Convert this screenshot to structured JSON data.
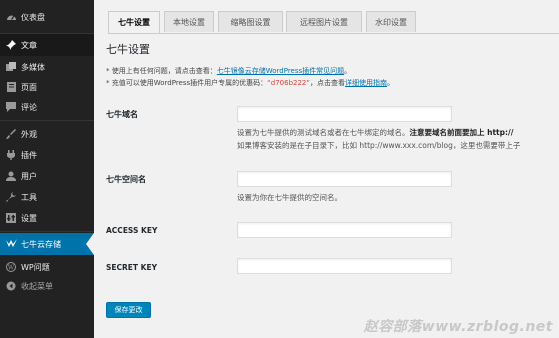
{
  "sidebar": {
    "items": [
      {
        "label": "仪表盘",
        "icon": "dashboard-icon"
      },
      {
        "label": "文章",
        "icon": "pin-icon"
      },
      {
        "label": "多媒体",
        "icon": "media-icon"
      },
      {
        "label": "页面",
        "icon": "page-icon"
      },
      {
        "label": "评论",
        "icon": "comment-icon"
      },
      {
        "label": "外观",
        "icon": "brush-icon"
      },
      {
        "label": "插件",
        "icon": "plugin-icon"
      },
      {
        "label": "用户",
        "icon": "user-icon"
      },
      {
        "label": "工具",
        "icon": "wrench-icon"
      },
      {
        "label": "设置",
        "icon": "settings-icon"
      },
      {
        "label": "七牛云存储",
        "icon": "qiniu-icon"
      },
      {
        "label": "WP问题",
        "icon": "wordpress-icon"
      },
      {
        "label": "收起菜单",
        "icon": "collapse-icon"
      }
    ],
    "colors": {
      "bg": "#222222",
      "active": "#0073aa"
    }
  },
  "tabs": [
    "七牛设置",
    "本地设置",
    "缩略图设置",
    "远程图片设置",
    "水印设置"
  ],
  "page": {
    "title": "七牛设置",
    "note1_prefix": "* 使用上有任何问题，请点击查看：",
    "note1_link": "七牛镜像云存储WordPress插件常见问题",
    "note1_suffix": "。",
    "note2_prefix": "* 充值可以使用WordPress插件用户专属的优惠码：",
    "note2_code": "“d706b222”",
    "note2_mid": "，点击查看",
    "note2_link": "详细使用指南",
    "note2_suffix": "。"
  },
  "fields": {
    "domain": {
      "label": "七牛域名",
      "value": "",
      "desc1_a": "设置为七牛提供的测试域名或者在七牛绑定的域名。",
      "desc1_b": "注意要域名前面要加上 http://",
      "desc2": "如果博客安装的是在子目录下，比如 http://www.xxx.com/blog，这里也需要带上子"
    },
    "bucket": {
      "label": "七牛空间名",
      "value": "",
      "desc": "设置为你在七牛提供的空间名。"
    },
    "access_key": {
      "label": "ACCESS KEY",
      "value": ""
    },
    "secret_key": {
      "label": "SECRET KEY",
      "value": ""
    }
  },
  "save_label": "保存更改",
  "watermark": "赵容部落www.zrblog.net"
}
